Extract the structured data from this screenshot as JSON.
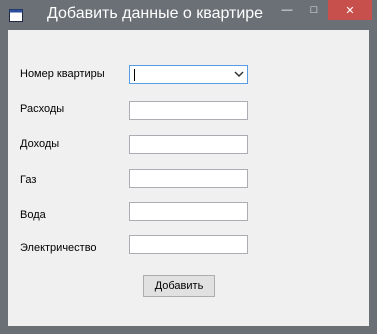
{
  "window": {
    "title": "Добавить данные о квартире",
    "controls": {
      "minimize": "—",
      "maximize": "□",
      "close": "✕"
    }
  },
  "form": {
    "apartment_number": {
      "label": "Номер квартиры",
      "value": ""
    },
    "fields": [
      {
        "label": "Расходы",
        "value": ""
      },
      {
        "label": "Доходы",
        "value": ""
      },
      {
        "label": "Газ",
        "value": ""
      },
      {
        "label": "Вода",
        "value": ""
      },
      {
        "label": "Электричество",
        "value": ""
      }
    ],
    "submit_label": "Добавить"
  }
}
